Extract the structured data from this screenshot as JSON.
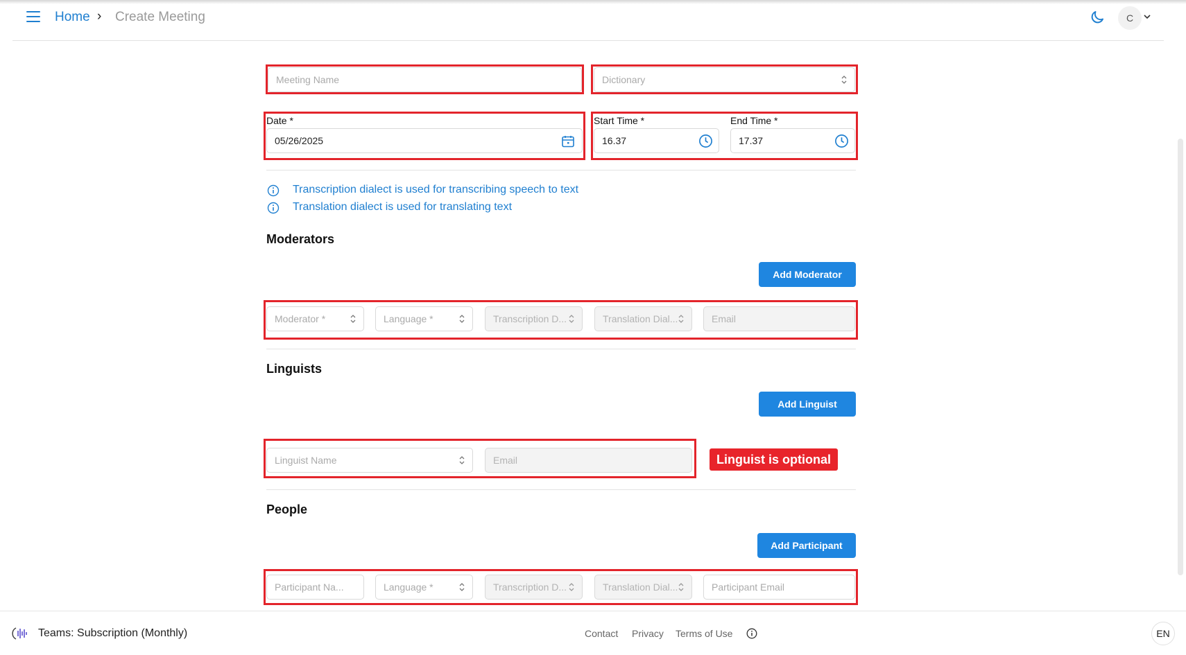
{
  "breadcrumb": {
    "home": "Home",
    "separator": "›",
    "current": "Create Meeting"
  },
  "user": {
    "initial": "C"
  },
  "form": {
    "meeting_name_placeholder": "Meeting Name",
    "dictionary_placeholder": "Dictionary",
    "date_label": "Date *",
    "date_value": "05/26/2025",
    "start_time_label": "Start Time *",
    "start_time_value": "16.37",
    "end_time_label": "End Time *",
    "end_time_value": "17.37"
  },
  "info": [
    "Transcription dialect is used for transcribing speech to text",
    "Translation dialect is used for translating text"
  ],
  "moderators": {
    "title": "Moderators",
    "add_label": "Add Moderator",
    "fields": {
      "moderator": "Moderator *",
      "language": "Language *",
      "transcription": "Transcription D...",
      "translation": "Translation Dial...",
      "email": "Email"
    }
  },
  "linguists": {
    "title": "Linguists",
    "add_label": "Add Linguist",
    "fields": {
      "name": "Linguist Name",
      "email": "Email"
    },
    "badge": "Linguist is optional"
  },
  "people": {
    "title": "People",
    "add_label": "Add Participant",
    "fields": {
      "name": "Participant Na...",
      "language": "Language *",
      "transcription": "Transcription D...",
      "translation": "Translation Dial...",
      "email": "Participant Email"
    }
  },
  "footer": {
    "plan": "Teams: Subscription (Monthly)",
    "links": [
      "Contact",
      "Privacy",
      "Terms of Use"
    ],
    "language": "EN"
  },
  "colors": {
    "accent": "#1f86e0",
    "highlight": "#e3242b"
  }
}
